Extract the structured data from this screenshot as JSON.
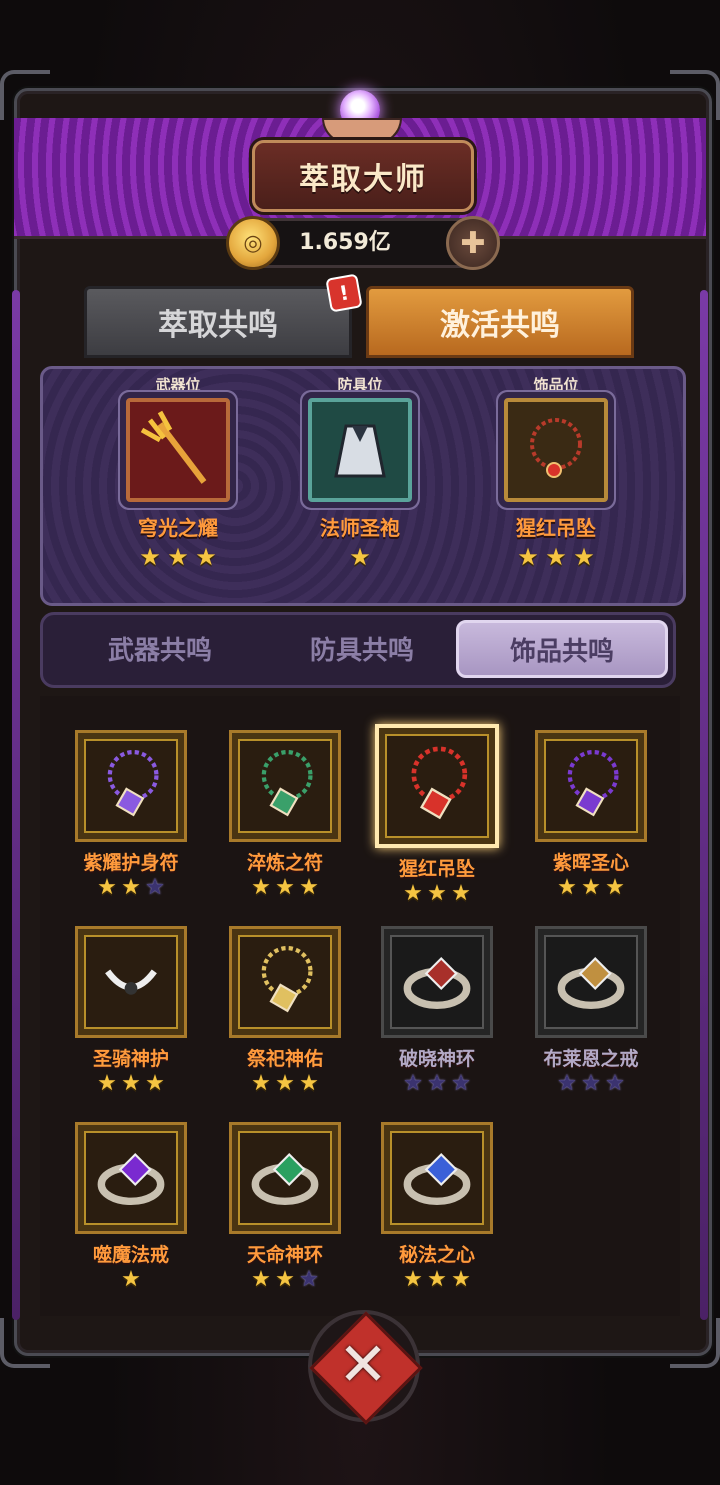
{
  "header": {
    "title": "萃取大师",
    "currency": "1.659亿"
  },
  "tabs": [
    {
      "label": "萃取共鸣",
      "active": false
    },
    {
      "label": "激活共鸣",
      "active": true
    }
  ],
  "equipped": [
    {
      "slot": "武器位",
      "name": "穹光之耀",
      "stars": 3,
      "icon": "trident-icon"
    },
    {
      "slot": "防具位",
      "name": "法师圣袍",
      "stars": 1,
      "icon": "robe-icon"
    },
    {
      "slot": "饰品位",
      "name": "猩红吊坠",
      "stars": 3,
      "icon": "pendant-icon"
    }
  ],
  "sub_tabs": [
    {
      "label": "武器共鸣",
      "active": false
    },
    {
      "label": "防具共鸣",
      "active": false
    },
    {
      "label": "饰品共鸣",
      "active": true
    }
  ],
  "items": [
    {
      "name": "紫耀护身符",
      "stars": 2,
      "max_stars": 3,
      "locked": false,
      "selected": false,
      "icon": "amulet-icon",
      "color": "#8a5ae0"
    },
    {
      "name": "淬炼之符",
      "stars": 3,
      "max_stars": 3,
      "locked": false,
      "selected": false,
      "icon": "necklace-icon",
      "color": "#3aa06a"
    },
    {
      "name": "猩红吊坠",
      "stars": 3,
      "max_stars": 3,
      "locked": false,
      "selected": true,
      "icon": "pendant-icon",
      "color": "#d8322a"
    },
    {
      "name": "紫晖圣心",
      "stars": 3,
      "max_stars": 3,
      "locked": false,
      "selected": false,
      "icon": "heart-pendant-icon",
      "color": "#7a3ad0"
    },
    {
      "name": "圣骑神护",
      "stars": 3,
      "max_stars": 3,
      "locked": false,
      "selected": false,
      "icon": "winged-charm-icon",
      "color": "#c8ccd4"
    },
    {
      "name": "祭祀神佑",
      "stars": 3,
      "max_stars": 3,
      "locked": false,
      "selected": false,
      "icon": "necklace-icon",
      "color": "#e0c060"
    },
    {
      "name": "破晓神环",
      "stars": 0,
      "max_stars": 3,
      "locked": true,
      "selected": false,
      "icon": "ring-icon",
      "color": "#a8302a"
    },
    {
      "name": "布莱恩之戒",
      "stars": 0,
      "max_stars": 3,
      "locked": true,
      "selected": false,
      "icon": "ring-icon",
      "color": "#c09040"
    },
    {
      "name": "噬魔法戒",
      "stars": 1,
      "max_stars": 1,
      "locked": false,
      "selected": false,
      "icon": "ring-icon",
      "color": "#7a2ad0"
    },
    {
      "name": "天命神环",
      "stars": 2,
      "max_stars": 3,
      "locked": false,
      "selected": false,
      "icon": "ring-icon",
      "color": "#2aa060"
    },
    {
      "name": "秘法之心",
      "stars": 3,
      "max_stars": 3,
      "locked": false,
      "selected": false,
      "icon": "ring-icon",
      "color": "#3a60d8"
    }
  ]
}
